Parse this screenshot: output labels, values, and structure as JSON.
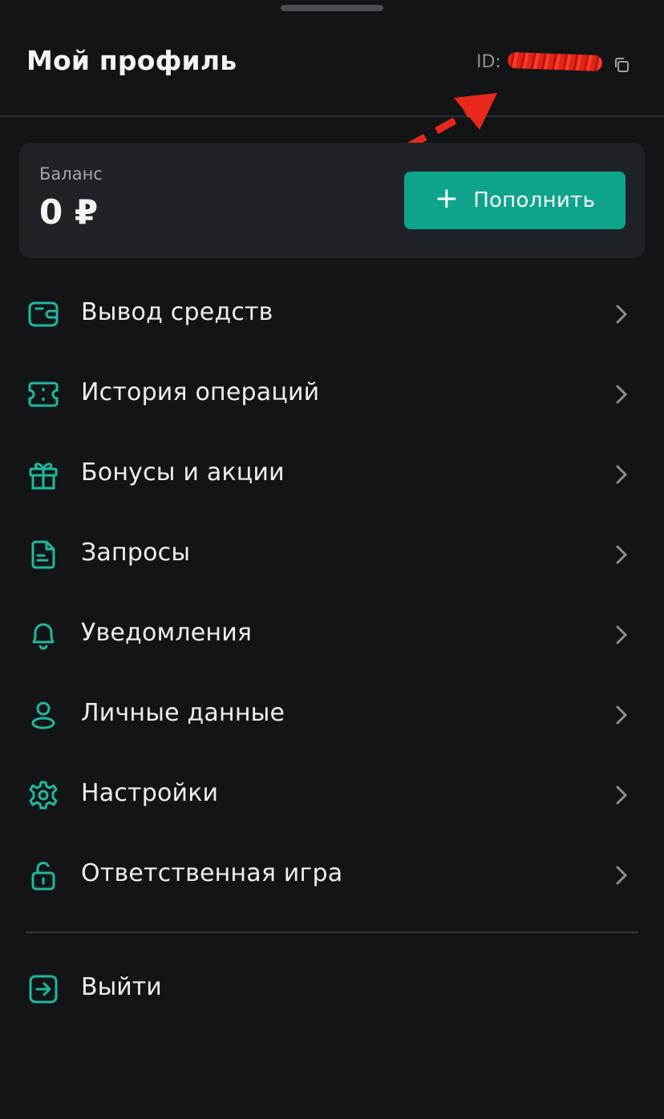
{
  "header": {
    "title": "Мой профиль",
    "id_label": "ID:",
    "id_value_redacted": true
  },
  "balance": {
    "label": "Баланс",
    "value": "0 ₽",
    "topup_label": "Пополнить",
    "topup_icon": "plus-icon"
  },
  "menu": {
    "items": [
      {
        "label": "Вывод средств",
        "icon": "wallet-icon"
      },
      {
        "label": "История операций",
        "icon": "ticket-icon"
      },
      {
        "label": "Бонусы и акции",
        "icon": "gift-icon"
      },
      {
        "label": "Запросы",
        "icon": "document-icon"
      },
      {
        "label": "Уведомления",
        "icon": "bell-icon"
      },
      {
        "label": "Личные данные",
        "icon": "user-icon"
      },
      {
        "label": "Настройки",
        "icon": "gear-icon"
      },
      {
        "label": "Ответственная игра",
        "icon": "lock-open-icon"
      }
    ]
  },
  "logout": {
    "label": "Выйти",
    "icon": "logout-icon"
  },
  "colors": {
    "background": "#121416",
    "card": "#1f2328",
    "accent": "#0ea48c",
    "icon": "#1fb8a0",
    "annotation_arrow": "#e8281c"
  }
}
